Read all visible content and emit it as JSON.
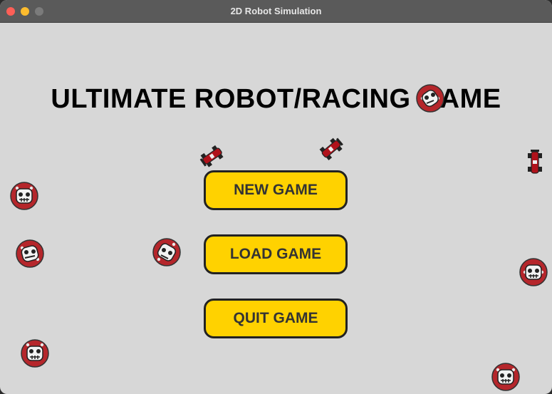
{
  "window": {
    "title": "2D Robot Simulation"
  },
  "game": {
    "title": "ULTIMATE ROBOT/RACING GAME"
  },
  "menu": {
    "new_game": "NEW GAME",
    "load_game": "LOAD GAME",
    "quit_game": "QUIT GAME"
  },
  "colors": {
    "background": "#d7d7d7",
    "button_fill": "#ffd200",
    "button_border": "#222222",
    "robot_red": "#b5262b",
    "car_red": "#b0121b"
  },
  "sprites": {
    "robots": "robot-skull-icon",
    "cars": "race-car-icon"
  }
}
